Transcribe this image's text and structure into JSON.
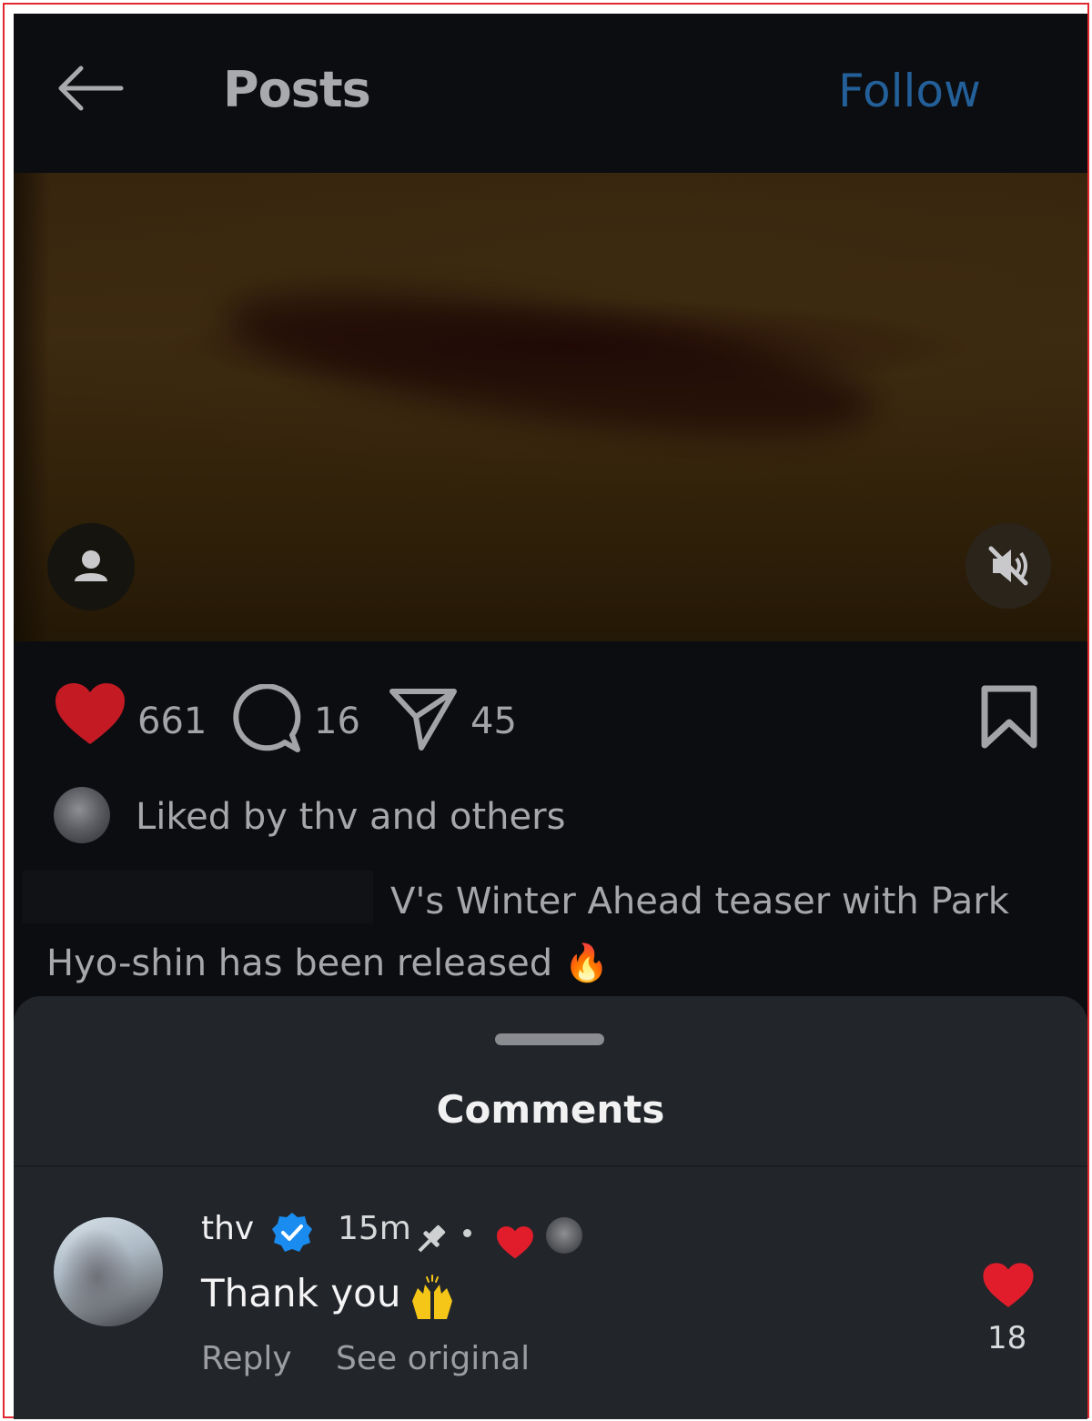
{
  "header": {
    "title": "Posts",
    "follow_label": "Follow"
  },
  "actions": {
    "likes": "661",
    "comments": "16",
    "shares": "45"
  },
  "liked_by": {
    "text": "Liked by thv and others"
  },
  "caption": {
    "text": "V's Winter Ahead teaser with Park Hyo-shin has been released 🔥"
  },
  "comments_sheet": {
    "title": "Comments",
    "comment": {
      "username": "thv",
      "time": "15m",
      "text": "Thank you",
      "emoji": "🙌",
      "reply_label": "Reply",
      "see_original_label": "See original",
      "like_count": "18"
    }
  },
  "colors": {
    "background": "#0c0d10",
    "follow": "#235f98",
    "like_red": "#e11d2b",
    "verified_blue": "#1a8cf0",
    "sheet": "#22252a"
  },
  "icons": [
    "back-arrow-icon",
    "user-tag-icon",
    "mute-icon",
    "heart-icon",
    "comment-icon",
    "share-icon",
    "bookmark-icon",
    "verified-icon",
    "pin-icon",
    "raising-hands-icon"
  ]
}
